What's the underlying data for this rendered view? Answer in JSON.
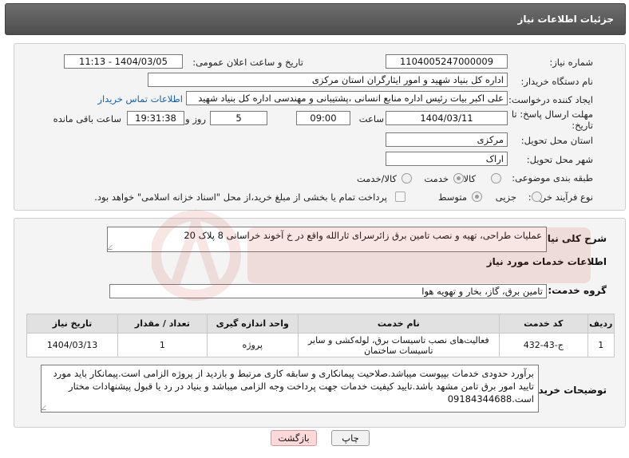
{
  "header": {
    "title": "جزئیات اطلاعات نیاز"
  },
  "need_info": {
    "need_number_label": "شماره نیاز:",
    "need_number": "1104005247000009",
    "announce_label": "تاریخ و ساعت اعلان عمومی:",
    "announce_value": "1404/03/05 - 11:13",
    "buyer_org_label": "نام دستگاه خریدار:",
    "buyer_org": "اداره کل بنیاد شهید و امور ایثارگران استان مرکزی",
    "creator_label": "ایجاد کننده درخواست:",
    "creator": "علی اکبر بیات رئیس اداره منابع انسانی ،پشتیبانی و مهندسی اداره کل بنیاد شهید",
    "contact_link": "اطلاعات تماس خریدار",
    "deadline_label_line1": "مهلت ارسال پاسخ: تا",
    "deadline_label_line2": "تاریخ:",
    "deadline_date": "1404/03/11",
    "time_label": "ساعت",
    "deadline_time": "09:00",
    "days_value": "5",
    "days_label": "روز و",
    "remaining_time": "19:31:38",
    "remaining_label": "ساعت باقی مانده",
    "province_label": "استان محل تحویل:",
    "province": "مرکزی",
    "city_label": "شهر محل تحویل:",
    "city": "اراک",
    "category_label": "طبقه بندی موضوعی:",
    "category_options": [
      "کالا",
      "خدمت",
      "کالا/خدمت"
    ],
    "category_selected": "خدمت",
    "process_label": "نوع فرآیند خرید :",
    "process_options": [
      "جزیی",
      "متوسط"
    ],
    "process_selected": "متوسط",
    "payment_note": "پرداخت تمام یا بخشی از مبلغ خرید،از محل \"اسناد خزانه اسلامی\" خواهد بود."
  },
  "general_desc": {
    "label": "شرح کلی نیاز:",
    "text": "عملیات طراحی، تهیه و نصب تامین برق زائرسرای ثارالله واقع در خ آخوند خراسانی 8 پلاک 20"
  },
  "services": {
    "section_title": "اطلاعات خدمات مورد نیاز",
    "group_label": "گروه خدمت:",
    "group_value": "تامین برق، گاز، بخار و تهویه هوا",
    "columns": [
      "ردیف",
      "کد خدمت",
      "نام خدمت",
      "واحد اندازه گیری",
      "تعداد / مقدار",
      "تاریخ نیاز"
    ],
    "rows": [
      {
        "row": "1",
        "code": "ج-43-432",
        "name": "فعالیت‌های نصب تاسیسات برق، لوله‌کشی و سایر تاسیسات ساختمان",
        "unit": "پروژه",
        "qty": "1",
        "date": "1404/03/13"
      }
    ]
  },
  "buyer_notes": {
    "label": "توضیحات خریدار:",
    "text": "برآورد حدودی خدمات بپیوست میباشد.صلاحیت پیمانکاری و سابقه کاری مرتبط و بازدید از پروژه الزامی است.پیمانکار باید مورد تایید امور برق تامن مشهد باشد.تایید کیفیت خدمات جهت پرداخت وجه الزامی میباشد و بنیاد در رد یا قبول پیشنهادات مختار است.09184344688"
  },
  "buttons": {
    "print": "چاپ",
    "back": "بازگشت"
  },
  "colors": {
    "header": "#5a5a5a",
    "link": "#1a5fa8",
    "back_button": "#ffd9d9"
  }
}
